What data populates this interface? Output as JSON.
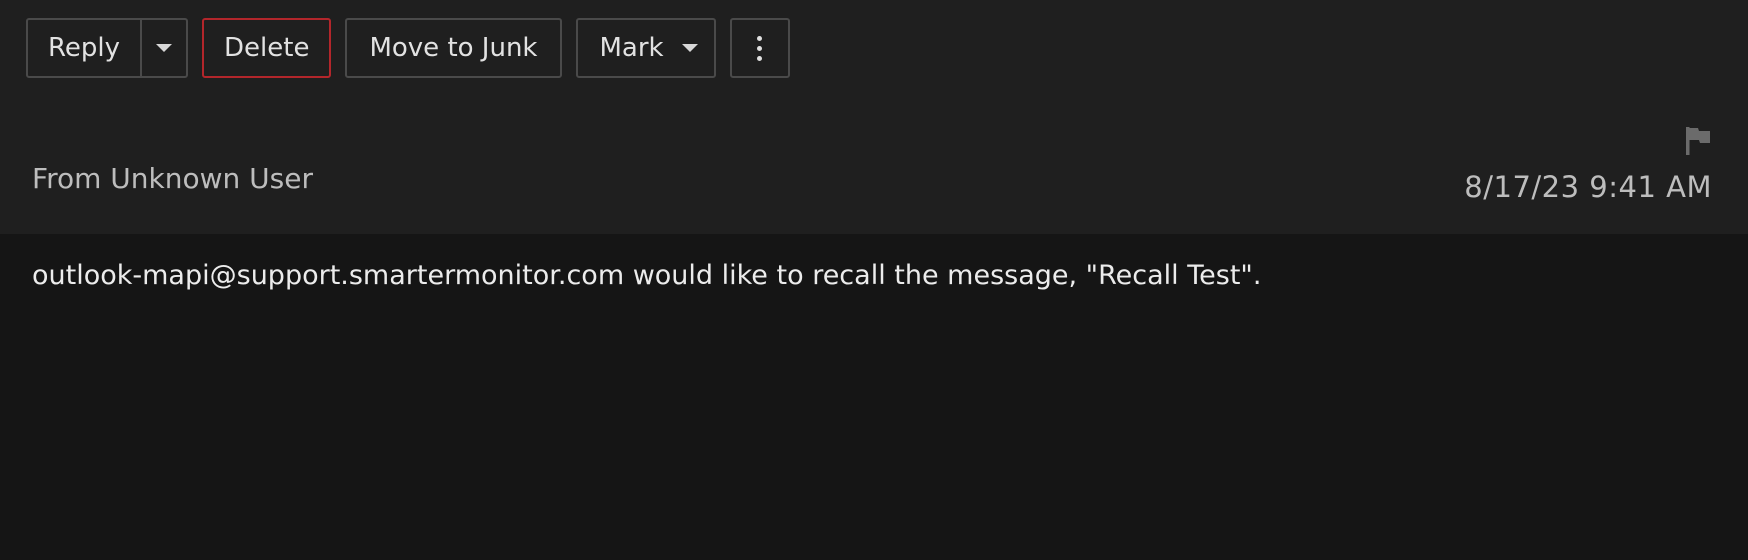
{
  "toolbar": {
    "reply_label": "Reply",
    "delete_label": "Delete",
    "junk_label": "Move to Junk",
    "mark_label": "Mark",
    "delete_border_color": "#b3262b"
  },
  "header": {
    "from_text": "From Unknown User",
    "date_text": "8/17/23 9:41 AM",
    "flag_icon": "flag-icon"
  },
  "message": {
    "body": "outlook-mapi@support.smartermonitor.com would like to recall the message, \"Recall Test\"."
  }
}
